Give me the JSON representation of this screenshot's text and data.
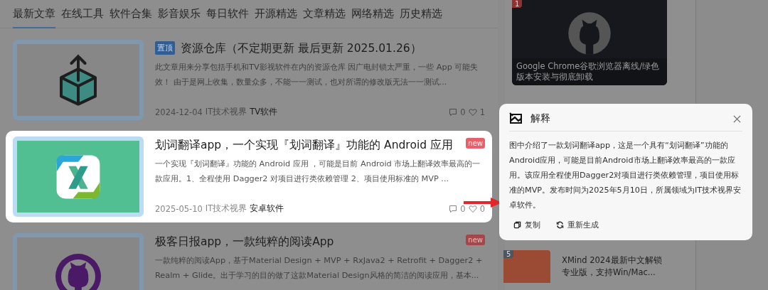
{
  "tabs": [
    {
      "label": "最新文章",
      "selected": true
    },
    {
      "label": "在线工具",
      "selected": false
    },
    {
      "label": "软件合集",
      "selected": false
    },
    {
      "label": "影音娱乐",
      "selected": false
    },
    {
      "label": "每日软件",
      "selected": false
    },
    {
      "label": "开源精选",
      "selected": false
    },
    {
      "label": "文章精选",
      "selected": false
    },
    {
      "label": "网络精选",
      "selected": false
    },
    {
      "label": "历史精选",
      "selected": false
    }
  ],
  "articles": [
    {
      "kind": "box",
      "highlighted": false,
      "badge": "置顶",
      "new": false,
      "title": "资源仓库（不定期更新 最后更新 2025.01.26）",
      "summary": "此文章用来分享包括手机和TV影视软件在内的资源仓库 因广电封锁太严重，一些 App 可能失效！ 由于是网上收集，数量众多，不能一一测试，也对所谓的修改版无法一一测试...",
      "date": "2024-12-04",
      "source": "IT技术视界",
      "category": "TV软件",
      "comments": "0",
      "likes": "1"
    },
    {
      "kind": "app",
      "highlighted": true,
      "new": true,
      "new_label": "new",
      "title": "划词翻译app，一个实现『划词翻译』功能的 Android 应用",
      "summary": "一个实现『划词翻译』功能的 Android 应用 ，可能是目前 Android 市场上翻译效率最高的一款应用。1、全程使用 Dagger2 对项目进行类依赖管理 2、项目使用标准的 MVP ...",
      "date": "2025-05-10",
      "source": "IT技术视界",
      "category": "安卓软件",
      "comments": "0",
      "likes": "0"
    },
    {
      "kind": "github",
      "highlighted": false,
      "new": true,
      "new_label": "new",
      "title": "极客日报app，一款纯粹的阅读App",
      "summary": "一款纯粹的阅读App，基于Material Design + MVP + RxJava2 + Retrofit + Dagger2 + Realm + Glide。出于学习的目的做了这款Material Design风格的简洁的阅读应用，基本..."
    }
  ],
  "sidebar": {
    "featured": {
      "rank": "1",
      "title": "Google Chrome谷歌浏览器离线/绿色版本安装与彻底卸载"
    },
    "hot_item": {
      "rank": "5",
      "title": "XMind 2024最新中文解锁专业版，支持Win/Mac..."
    }
  },
  "popup": {
    "title": "解释",
    "body": "图中介绍了一款划词翻译app，这是一个具有“划词翻译”功能的Android应用，可能是目前Android市场上翻译效率最高的一款应用。该应用全程使用Dagger2对项目进行类依赖管理，项目使用标准的MVP。发布时间为2025年5月10日，所属领域为IT技术视界安卓软件。",
    "actions": [
      {
        "kind": "copy",
        "label": "复制"
      },
      {
        "kind": "regenerate",
        "label": "重新生成"
      }
    ]
  }
}
